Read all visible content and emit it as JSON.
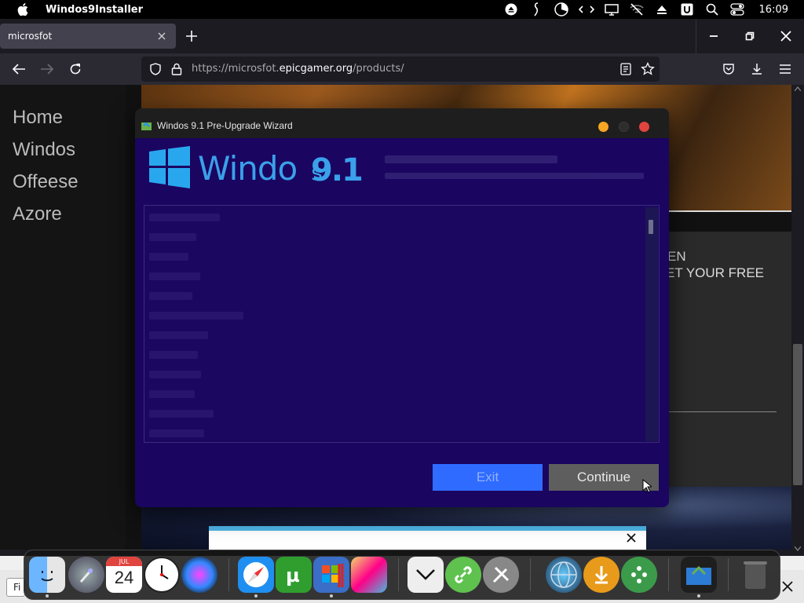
{
  "menubar": {
    "app_name": "Windos9Installer",
    "clock": "16:09"
  },
  "browser": {
    "tab_title": "microsfot",
    "url_prefix": "https://microsfot.",
    "url_domain": "epicgamer.org",
    "url_path": "/products/"
  },
  "page": {
    "nav": [
      "Home",
      "Windos",
      "Offeese",
      "Azore"
    ],
    "promo_line1": "EN",
    "promo_line2": "ET YOUR FREE"
  },
  "wizard": {
    "title": "Windos 9.1 Pre-Upgrade Wizard",
    "brand": "Windo",
    "brand_tail": "s",
    "version": "9.1",
    "exit_label": "Exit",
    "continue_label": "Continue"
  },
  "bottom": {
    "find_label": "Fi"
  },
  "dock": {
    "calendar_month": "JUL",
    "calendar_day": "24",
    "items": [
      "finder",
      "launchpad",
      "calendar",
      "clock",
      "siri",
      "safari",
      "utorrent",
      "parallels",
      "photo-editor",
      "downloads-folder",
      "link-tool",
      "system-tools",
      "globe",
      "download-manager",
      "network-tool",
      "installer",
      "trash"
    ]
  },
  "colors": {
    "wizard_bg": "#1a0560",
    "brand_blue": "#3aa0ea",
    "exit_btn": "#2f6bff",
    "continue_btn": "#5e5e5e"
  }
}
